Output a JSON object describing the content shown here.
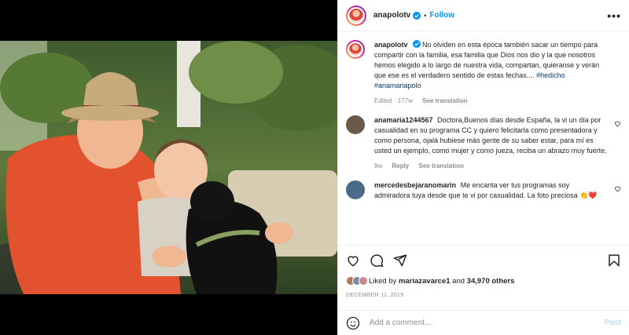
{
  "post": {
    "author": "anapolotv",
    "follow_label": "Follow",
    "more_label": "•••",
    "separator": "•"
  },
  "caption": {
    "username": "anapolotv",
    "text": "No olviden en esta época también sacar un tiempo para compartir con la familia, esa familia que Dios nos dio y la que nosotros hemos elegido a lo largo de nuestra vida, compartan, quieranse y verán que ese es el verdadero sentido de estas fechas....",
    "hashtags": "#hedicho #anamariapolo",
    "edited": "Edited · 177w",
    "see_translation": "See translation"
  },
  "comments": [
    {
      "username": "anamaria1244567",
      "text": "Doctora,Buenos días desde España, la vi un día por casualidad en su programa CC y quiero felicitarla como presentadora y como persona, ojalá hubiese más gente de su saber estar, para mí es usted un ejemplo, como mujer y como jueza, reciba un abrazo muy fuerte.",
      "time": "9w",
      "reply": "Reply",
      "see_translation": "See translation",
      "avatar_color": "#6b5a4a"
    },
    {
      "username": "mercedesbejaranomarin",
      "text": "Me encanta ver tus programas soy admiradora tuya desde que te vi por casualidad. La foto preciosa",
      "emoji": "👏❤️",
      "avatar_color": "#4a6a8a"
    }
  ],
  "likes": {
    "prefix": "Liked by",
    "user": "mariazavarce1",
    "and": "and",
    "count": "34,970 others"
  },
  "date": "DECEMBER 11, 2019",
  "add_comment": {
    "placeholder": "Add a comment...",
    "post_label": "Post"
  },
  "colors": {
    "link": "#0095f6",
    "hashtag": "#00376b",
    "muted": "#8e8e8e"
  }
}
